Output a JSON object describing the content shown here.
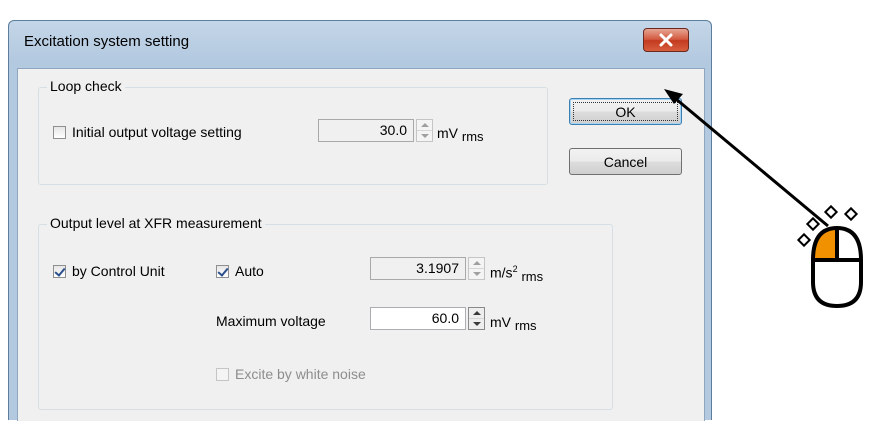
{
  "window": {
    "title": "Excitation system setting",
    "close_icon": "close-x-icon"
  },
  "buttons": {
    "ok_label": "OK",
    "cancel_label": "Cancel"
  },
  "loop_check": {
    "group_label": "Loop check",
    "initial_output_label": "Initial output voltage setting",
    "initial_output_checked": false,
    "voltage_value": "30.0",
    "voltage_unit": "mV",
    "voltage_unit_sub": "rms"
  },
  "xfr": {
    "group_label": "Output level at XFR measurement",
    "by_control_unit_label": "by Control Unit",
    "by_control_unit_checked": true,
    "auto_label": "Auto",
    "auto_checked": true,
    "accel_value": "3.1907",
    "accel_unit": "m/s",
    "accel_unit_sup": "2",
    "accel_unit_sub": "rms",
    "max_voltage_label": "Maximum voltage",
    "max_voltage_value": "60.0",
    "max_voltage_unit": "mV",
    "max_voltage_unit_sub": "rms",
    "white_noise_label": "Excite by white noise",
    "white_noise_checked": false,
    "white_noise_enabled": false
  },
  "annotation": {
    "pointer_icon": "arrow-icon",
    "mouse_icon": "mouse-left-click-icon",
    "accent_color": "#f29100"
  }
}
